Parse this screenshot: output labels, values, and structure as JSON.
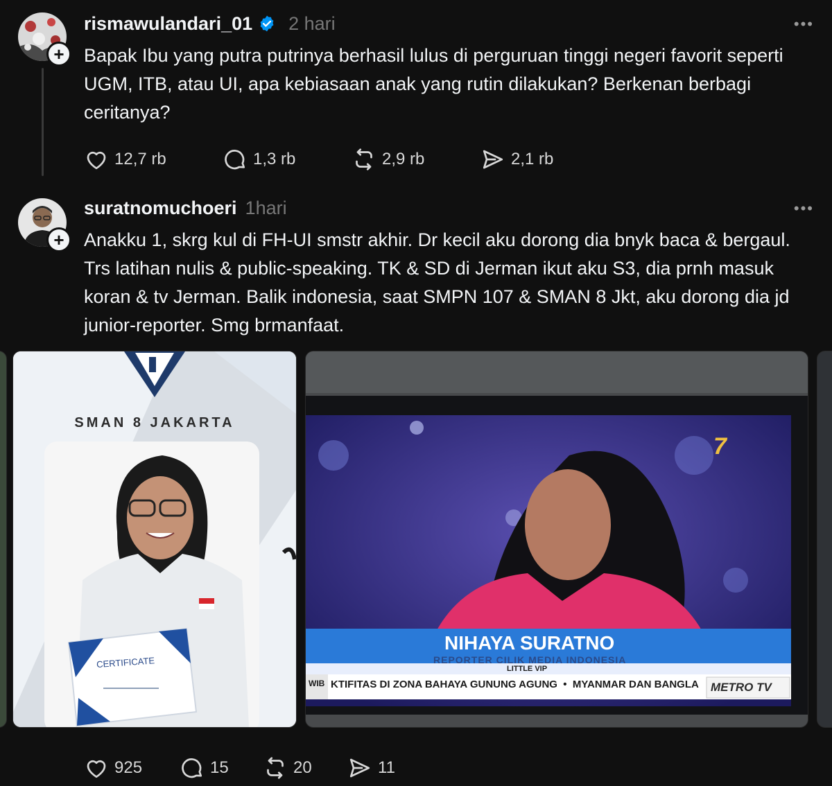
{
  "post1": {
    "username": "rismawulandari_01",
    "time": "2 hari",
    "more": "•••",
    "text": "Bapak Ibu yang putra putrinya berhasil lulus di perguruan tinggi negeri favorit seperti UGM, ITB, atau UI, apa kebiasaan anak yang rutin dilakukan? Berkenan berbagi ceritanya?",
    "likes": "12,7 rb",
    "replies": "1,3 rb",
    "reposts": "2,9 rb",
    "shares": "2,1 rb"
  },
  "post2": {
    "username": "suratnomuchoeri",
    "time": "1hari",
    "more": "•••",
    "text": "Anakku 1, skrg kul di FH-UI smstr akhir. Dr kecil aku dorong dia bnyk baca & bergaul. Trs latihan nulis & public-speaking. TK & SD di Jerman ikut aku S3, dia prnh masuk koran & tv Jerman. Balik indonesia, saat SMPN 107 & SMAN 8 Jkt, aku dorong dia jd junior-reporter. Smg brmanfaat.",
    "likes": "925",
    "replies": "15",
    "reposts": "20",
    "shares": "11",
    "image1": {
      "school": "SMAN 8 JAKARTA",
      "certificate": "CERTIFICATE"
    },
    "image2": {
      "name": "NIHAYA SURATNO",
      "role": "REPORTER CILIK MEDIA INDONESIA",
      "show": "LITTLE VIP",
      "ticker_label": "WIB",
      "ticker": "KTIFITAS DI ZONA BAHAYA GUNUNG AGUNG  •  MYANMAR DAN BANGLA",
      "channel": "METRO TV",
      "corner": "7"
    }
  },
  "colors": {
    "background": "#101010",
    "text": "#f3f5f7",
    "muted": "#777777",
    "verified": "#0095f6"
  },
  "icons": [
    "heart-icon",
    "comment-icon",
    "repost-icon",
    "share-icon",
    "verified-icon",
    "plus-icon",
    "more-icon"
  ]
}
